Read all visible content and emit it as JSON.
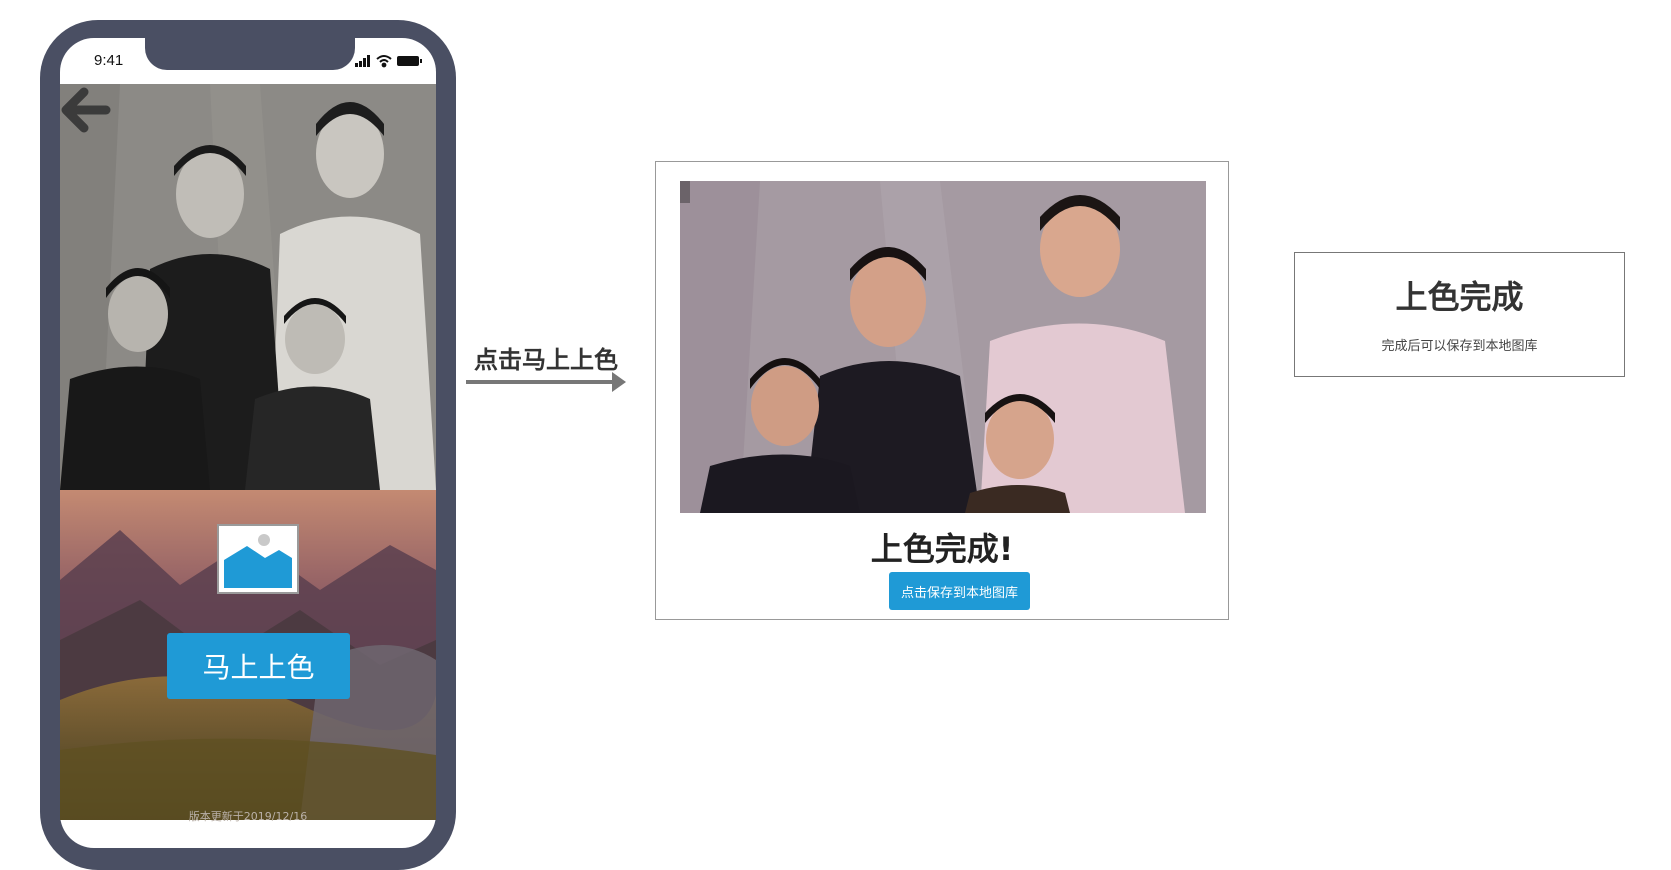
{
  "phone": {
    "status_time": "9:41",
    "colorize_button": "马上上色",
    "version_text": "版本更新于2019/12/16"
  },
  "flow": {
    "step_label": "点击马上上色"
  },
  "result": {
    "title": "上色完成!",
    "save_button": "点击保存到本地图库"
  },
  "dialog": {
    "title": "上色完成",
    "subtitle": "完成后可以保存到本地图库"
  },
  "colors": {
    "phone_frame": "#4a4f63",
    "accent_button": "#1f9ad6"
  },
  "icons": [
    "back-arrow-icon",
    "image-placeholder-icon",
    "signal-icon",
    "wifi-icon",
    "battery-icon"
  ]
}
